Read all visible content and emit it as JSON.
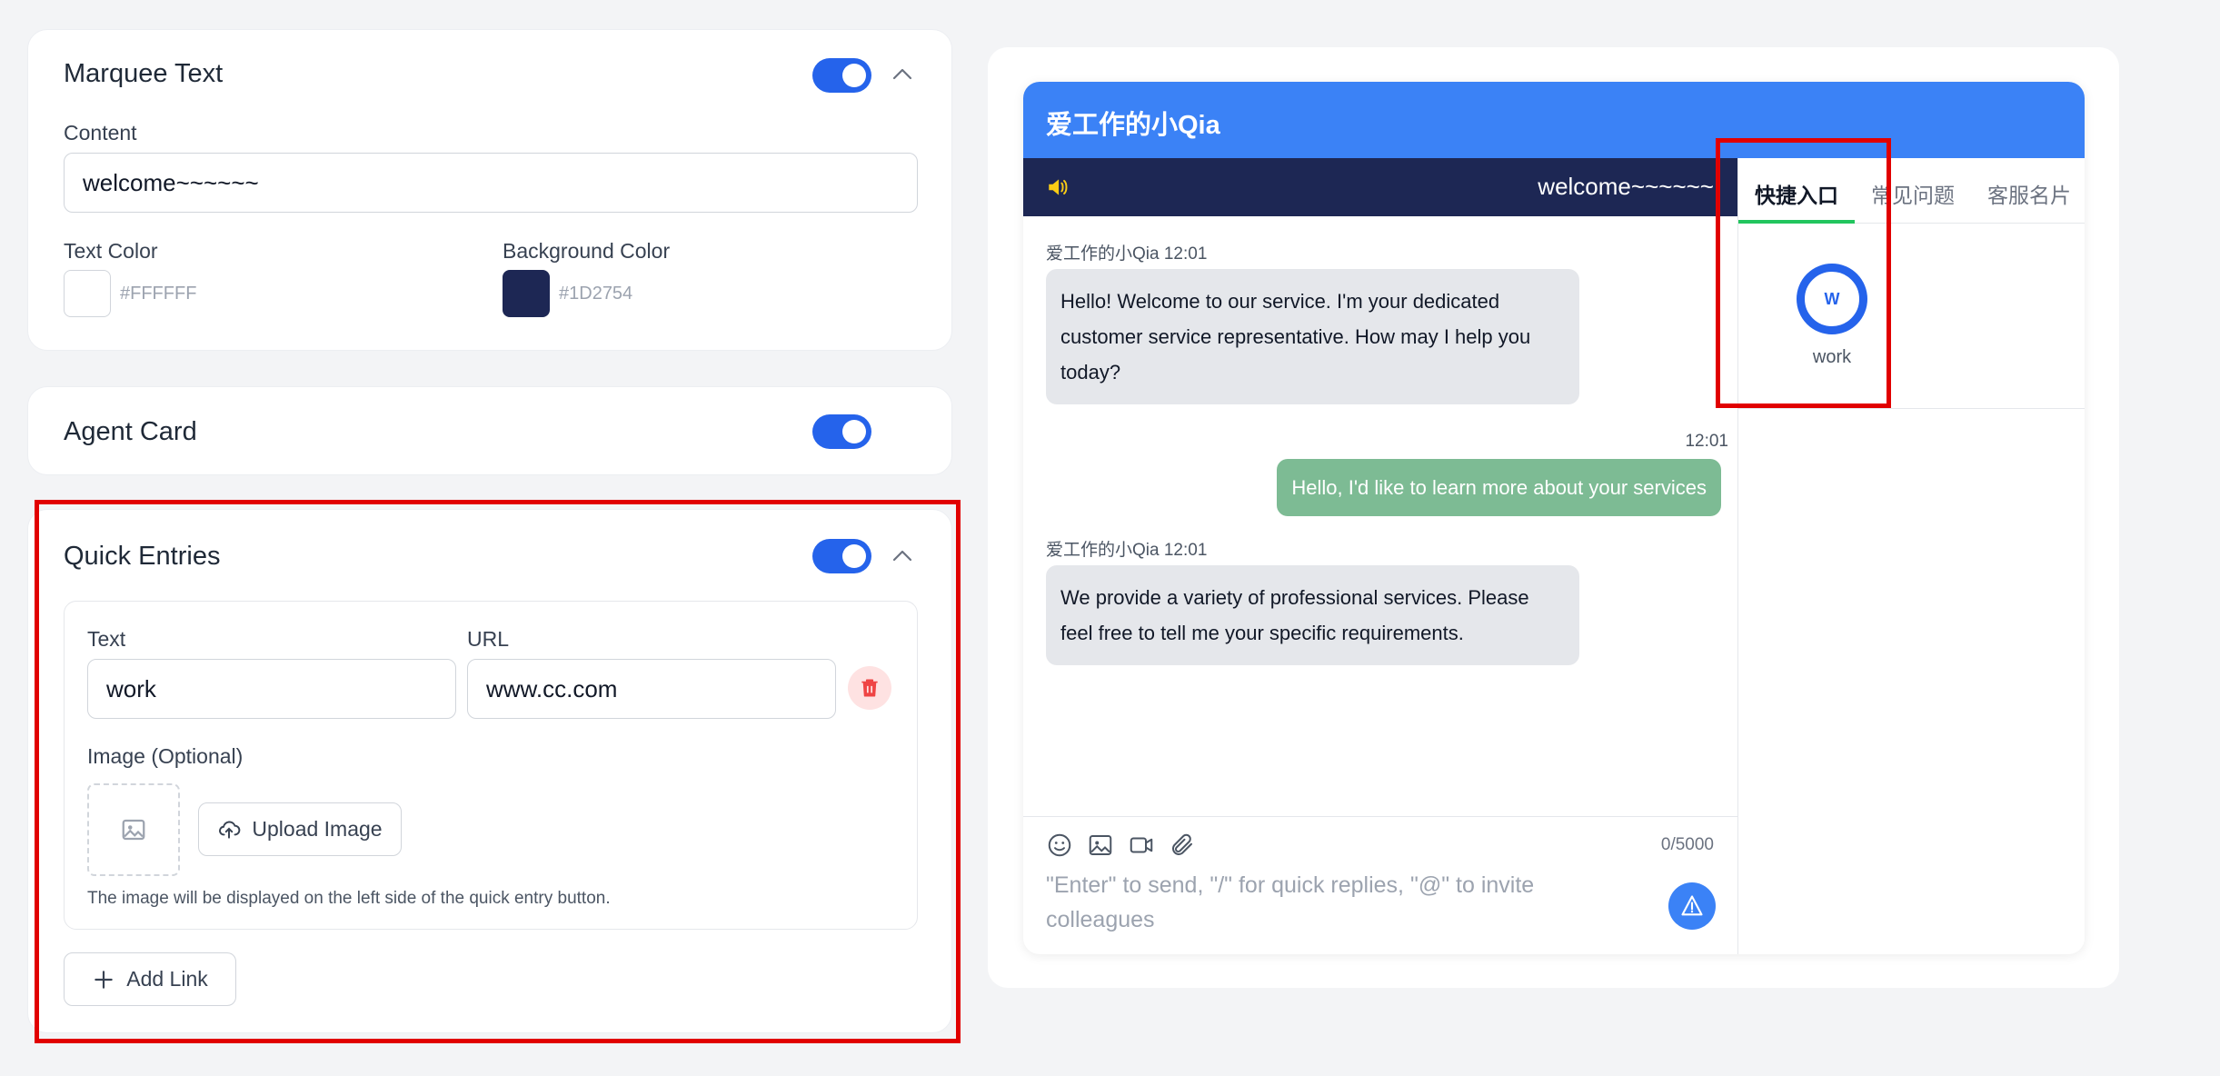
{
  "marquee_card": {
    "title": "Marquee Text",
    "content_label": "Content",
    "content_value": "welcome~~~~~~",
    "text_color_label": "Text Color",
    "text_color_value": "#FFFFFF",
    "bg_color_label": "Background Color",
    "bg_color_value": "#1D2754"
  },
  "agent_card": {
    "title": "Agent Card"
  },
  "quick_entries": {
    "title": "Quick Entries",
    "text_label": "Text",
    "text_value": "work",
    "url_label": "URL",
    "url_value": "www.cc.com",
    "image_label": "Image (Optional)",
    "upload_label": "Upload Image",
    "hint": "The image will be displayed on the left side of the quick entry button.",
    "add_link_label": "Add Link"
  },
  "preview": {
    "title": "爱工作的小Qia",
    "marquee_text": "welcome~~~~~~",
    "tabs": [
      "快捷入口",
      "常见问题",
      "客服名片"
    ],
    "entry": {
      "initial": "W",
      "label": "work"
    },
    "messages": [
      {
        "meta": "爱工作的小Qia 12:01",
        "text": "Hello! Welcome to our service. I'm your dedicated customer service representative. How may I help you today?"
      },
      {
        "meta": "12:01",
        "text": "Hello, I'd like to learn more about your services"
      },
      {
        "meta": "爱工作的小Qia 12:01",
        "text": "We provide a variety of professional services. Please feel free to tell me your specific requirements."
      }
    ],
    "counter": "0/5000",
    "placeholder": "\"Enter\" to send, \"/\" for quick replies, \"@\" to invite colleagues"
  },
  "colors": {
    "toggle_on": "#2563eb",
    "header_blue": "#3b82f6",
    "marquee_bg": "#1D2754",
    "marquee_text": "#FFFFFF",
    "user_bubble": "#7dbb94",
    "highlight_red": "#e10000"
  }
}
